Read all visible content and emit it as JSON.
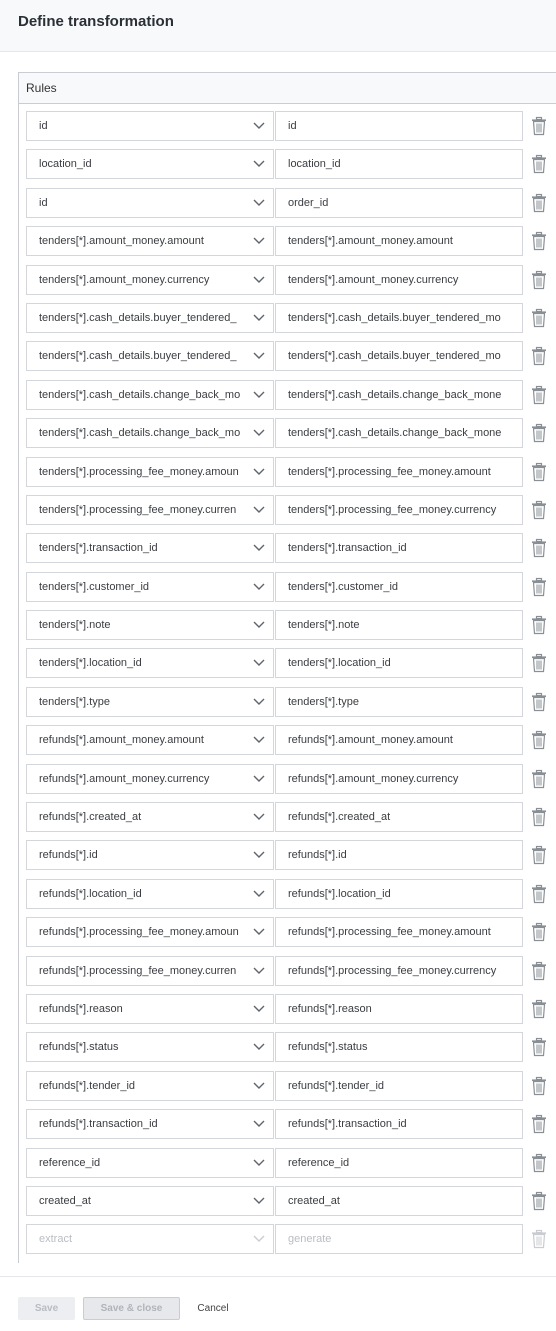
{
  "header": {
    "title": "Define transformation"
  },
  "rules": {
    "title": "Rules",
    "rows": [
      {
        "source": "id",
        "target": "id"
      },
      {
        "source": "location_id",
        "target": "location_id"
      },
      {
        "source": "id",
        "target": "order_id"
      },
      {
        "source": "tenders[*].amount_money.amount",
        "target": "tenders[*].amount_money.amount"
      },
      {
        "source": "tenders[*].amount_money.currency",
        "target": "tenders[*].amount_money.currency"
      },
      {
        "source": "tenders[*].cash_details.buyer_tendered_",
        "target": "tenders[*].cash_details.buyer_tendered_mo"
      },
      {
        "source": "tenders[*].cash_details.buyer_tendered_",
        "target": "tenders[*].cash_details.buyer_tendered_mo"
      },
      {
        "source": "tenders[*].cash_details.change_back_mo",
        "target": "tenders[*].cash_details.change_back_mone"
      },
      {
        "source": "tenders[*].cash_details.change_back_mo",
        "target": "tenders[*].cash_details.change_back_mone"
      },
      {
        "source": "tenders[*].processing_fee_money.amoun",
        "target": "tenders[*].processing_fee_money.amount"
      },
      {
        "source": "tenders[*].processing_fee_money.curren",
        "target": "tenders[*].processing_fee_money.currency"
      },
      {
        "source": "tenders[*].transaction_id",
        "target": "tenders[*].transaction_id"
      },
      {
        "source": "tenders[*].customer_id",
        "target": "tenders[*].customer_id"
      },
      {
        "source": "tenders[*].note",
        "target": "tenders[*].note"
      },
      {
        "source": "tenders[*].location_id",
        "target": "tenders[*].location_id"
      },
      {
        "source": "tenders[*].type",
        "target": "tenders[*].type"
      },
      {
        "source": "refunds[*].amount_money.amount",
        "target": "refunds[*].amount_money.amount"
      },
      {
        "source": "refunds[*].amount_money.currency",
        "target": "refunds[*].amount_money.currency"
      },
      {
        "source": "refunds[*].created_at",
        "target": "refunds[*].created_at"
      },
      {
        "source": "refunds[*].id",
        "target": "refunds[*].id"
      },
      {
        "source": "refunds[*].location_id",
        "target": "refunds[*].location_id"
      },
      {
        "source": "refunds[*].processing_fee_money.amoun",
        "target": "refunds[*].processing_fee_money.amount"
      },
      {
        "source": "refunds[*].processing_fee_money.curren",
        "target": "refunds[*].processing_fee_money.currency"
      },
      {
        "source": "refunds[*].reason",
        "target": "refunds[*].reason"
      },
      {
        "source": "refunds[*].status",
        "target": "refunds[*].status"
      },
      {
        "source": "refunds[*].tender_id",
        "target": "refunds[*].tender_id"
      },
      {
        "source": "refunds[*].transaction_id",
        "target": "refunds[*].transaction_id"
      },
      {
        "source": "reference_id",
        "target": "reference_id"
      },
      {
        "source": "created_at",
        "target": "created_at"
      }
    ],
    "new_row": {
      "source_placeholder": "extract",
      "target_placeholder": "generate"
    }
  },
  "footer": {
    "save_label": "Save",
    "save_close_label": "Save & close",
    "cancel_label": "Cancel"
  },
  "icons": {
    "dropdown": "chevron-down-icon",
    "delete": "trash-icon"
  },
  "colors": {
    "border": "#d3d7dc",
    "icon": "#8a8f96",
    "icon_disabled": "#c9ccd1",
    "placeholder": "#b9bdc3"
  }
}
